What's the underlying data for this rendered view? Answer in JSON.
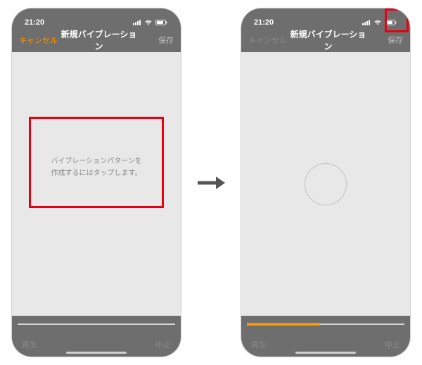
{
  "status": {
    "time": "21:20",
    "signal": "▪▪▮▮",
    "wifi": "◉",
    "battery": "▮▮"
  },
  "nav": {
    "cancel": "キャンセル",
    "title": "新規バイブレーション",
    "save": "保存"
  },
  "hint": {
    "line1": "バイブレーションパターンを",
    "line2": "作成するにはタップします。"
  },
  "bottom": {
    "play": "再生",
    "stop": "中止"
  },
  "arrow": "→"
}
